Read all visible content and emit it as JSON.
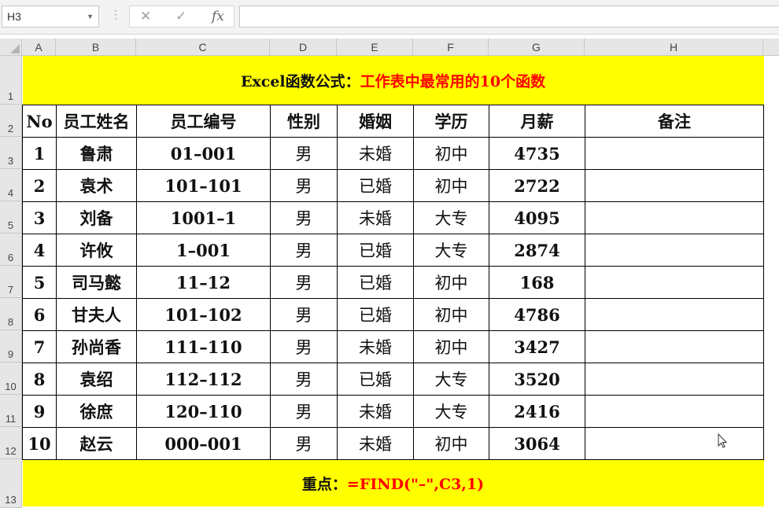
{
  "formula_bar": {
    "name_box": "H3",
    "cancel_glyph": "✕",
    "enter_glyph": "✓",
    "fx_glyph": "fx",
    "formula": ""
  },
  "columns": [
    "A",
    "B",
    "C",
    "D",
    "E",
    "F",
    "G",
    "H"
  ],
  "rows": [
    "1",
    "2",
    "3",
    "4",
    "5",
    "6",
    "7",
    "8",
    "9",
    "10",
    "11",
    "12",
    "13"
  ],
  "title": {
    "prefix": "Excel函数公式：",
    "highlight": "工作表中最常用的10个函数"
  },
  "table": {
    "headers": [
      "No",
      "员工姓名",
      "员工编号",
      "性别",
      "婚姻",
      "学历",
      "月薪",
      "备注"
    ],
    "rows": [
      [
        "1",
        "鲁肃",
        "01–001",
        "男",
        "未婚",
        "初中",
        "4735",
        ""
      ],
      [
        "2",
        "袁术",
        "101–101",
        "男",
        "已婚",
        "初中",
        "2722",
        ""
      ],
      [
        "3",
        "刘备",
        "1001–1",
        "男",
        "未婚",
        "大专",
        "4095",
        ""
      ],
      [
        "4",
        "许攸",
        "1–001",
        "男",
        "已婚",
        "大专",
        "2874",
        ""
      ],
      [
        "5",
        "司马懿",
        "11–12",
        "男",
        "已婚",
        "初中",
        "168",
        ""
      ],
      [
        "6",
        "甘夫人",
        "101–102",
        "男",
        "已婚",
        "初中",
        "4786",
        ""
      ],
      [
        "7",
        "孙尚香",
        "111–110",
        "男",
        "未婚",
        "初中",
        "3427",
        ""
      ],
      [
        "8",
        "袁绍",
        "112–112",
        "男",
        "已婚",
        "大专",
        "3520",
        ""
      ],
      [
        "9",
        "徐庶",
        "120–110",
        "男",
        "未婚",
        "大专",
        "2416",
        ""
      ],
      [
        "10",
        "赵云",
        "000–001",
        "男",
        "未婚",
        "初中",
        "3064",
        ""
      ]
    ]
  },
  "note": {
    "label": "重点：",
    "formula": "=FIND(\"–\",C3,1)"
  },
  "colors": {
    "banner": "#ffff00",
    "accent": "#ff0000",
    "header_bg": "#e6e6e6"
  }
}
